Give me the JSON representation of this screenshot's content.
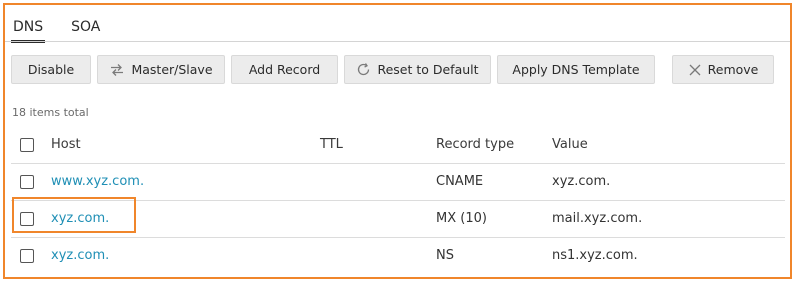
{
  "tabs": [
    {
      "label": "DNS",
      "active": true
    },
    {
      "label": "SOA",
      "active": false
    }
  ],
  "toolbar": {
    "disable": "Disable",
    "master_slave": "Master/Slave",
    "add_record": "Add Record",
    "reset_default": "Reset to Default",
    "apply_template": "Apply DNS Template",
    "remove": "Remove"
  },
  "items_total": "18 items total",
  "columns": {
    "host": "Host",
    "ttl": "TTL",
    "record_type": "Record type",
    "value": "Value"
  },
  "rows": [
    {
      "host": "www.xyz.com.",
      "ttl": "",
      "type": "CNAME",
      "value": "xyz.com."
    },
    {
      "host": "xyz.com.",
      "ttl": "",
      "type": "MX (10)",
      "value": "mail.xyz.com."
    },
    {
      "host": "xyz.com.",
      "ttl": "",
      "type": "NS",
      "value": "ns1.xyz.com."
    }
  ],
  "colors": {
    "accent_highlight": "#f0862b",
    "link": "#1f8fb5",
    "button_bg": "#ececec"
  },
  "icons": {
    "master_slave": "swap-arrows-icon",
    "reset": "reset-icon",
    "remove": "remove-x-icon"
  }
}
